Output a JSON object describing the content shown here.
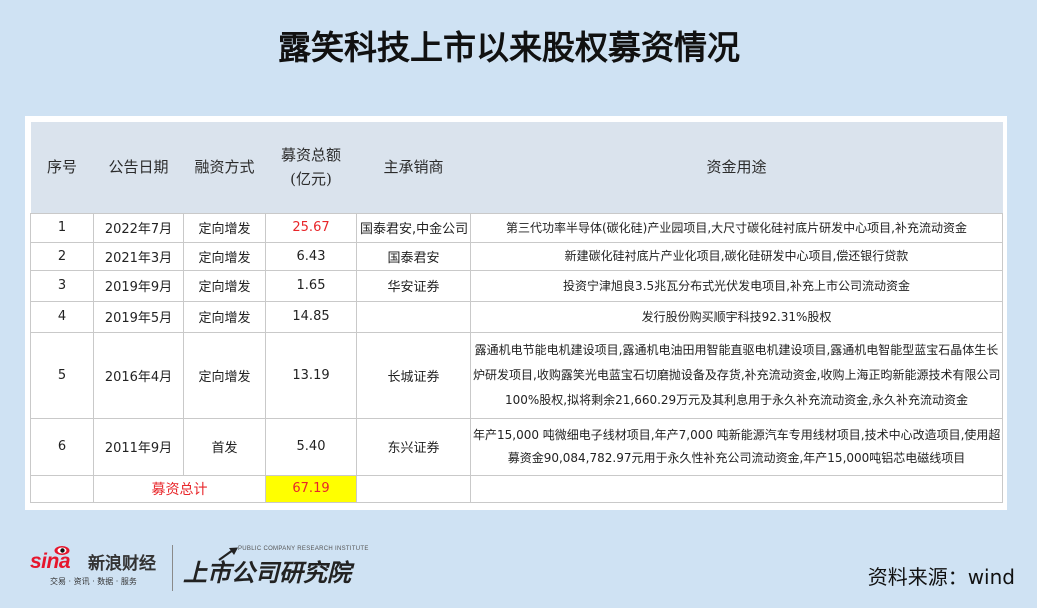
{
  "title": "露笑科技上市以来股权募资情况",
  "table": {
    "headers": {
      "index": "序号",
      "date": "公告日期",
      "method": "融资方式",
      "amount_line1": "募资总额",
      "amount_line2": "(亿元)",
      "underwriter": "主承销商",
      "purpose": "资金用途"
    },
    "rows": [
      {
        "index": "1",
        "date": "2022年7月",
        "method": "定向增发",
        "amount": "25.67",
        "underwriter": "国泰君安,中金公司",
        "purpose": [
          "第三代功率半导体(碳化硅)产业园项目,大尺寸碳化硅衬底片研发中心项目,补充流动资金"
        ]
      },
      {
        "index": "2",
        "date": "2021年3月",
        "method": "定向增发",
        "amount": "6.43",
        "underwriter": "国泰君安",
        "purpose": [
          "新建碳化硅衬底片产业化项目,碳化硅研发中心项目,偿还银行贷款"
        ]
      },
      {
        "index": "3",
        "date": "2019年9月",
        "method": "定向增发",
        "amount": "1.65",
        "underwriter": "华安证券",
        "purpose": [
          "投资宁津旭良3.5兆瓦分布式光伏发电项目,补充上市公司流动资金"
        ]
      },
      {
        "index": "4",
        "date": "2019年5月",
        "method": "定向增发",
        "amount": "14.85",
        "underwriter": "",
        "purpose": [
          "发行股份购买顺宇科技92.31%股权"
        ]
      },
      {
        "index": "5",
        "date": "2016年4月",
        "method": "定向增发",
        "amount": "13.19",
        "underwriter": "长城证券",
        "purpose": [
          "露通机电节能电机建设项目,露通机电油田用智能直驱电机建设项目,露通机电智能型蓝宝石晶体生长",
          "炉研发项目,收购露笑光电蓝宝石切磨抛设备及存货,补充流动资金,收购上海正昀新能源技术有限公司",
          "100%股权,拟将剩余21,660.29万元及其利息用于永久补充流动资金,永久补充流动资金"
        ]
      },
      {
        "index": "6",
        "date": "2011年9月",
        "method": "首发",
        "amount": "5.40",
        "underwriter": "东兴证券",
        "purpose": [
          "年产15,000 吨微细电子线材项目,年产7,000 吨新能源汽车专用线材项目,技术中心改造项目,使用超",
          "募资金90,084,782.97元用于永久性补充公司流动资金,年产15,000吨铝芯电磁线项目"
        ]
      }
    ],
    "total": {
      "label": "募资总计",
      "amount": "67.19"
    }
  },
  "footer": {
    "sina_wordmark": "sina",
    "sina_brand": "新浪财经",
    "sina_tagline": "交易 · 资讯 · 数据 · 服务",
    "institute_en": "PUBLIC COMPANY RESEARCH INSTITUTE",
    "institute_cn": "上市公司研究院",
    "source": "资料来源：wind"
  },
  "colors": {
    "background": "#cfe2f3",
    "header_background": "#dae3ed",
    "highlight_red": "#e8262a",
    "total_fill": "#ffff00",
    "sina_red": "#e6162d"
  }
}
